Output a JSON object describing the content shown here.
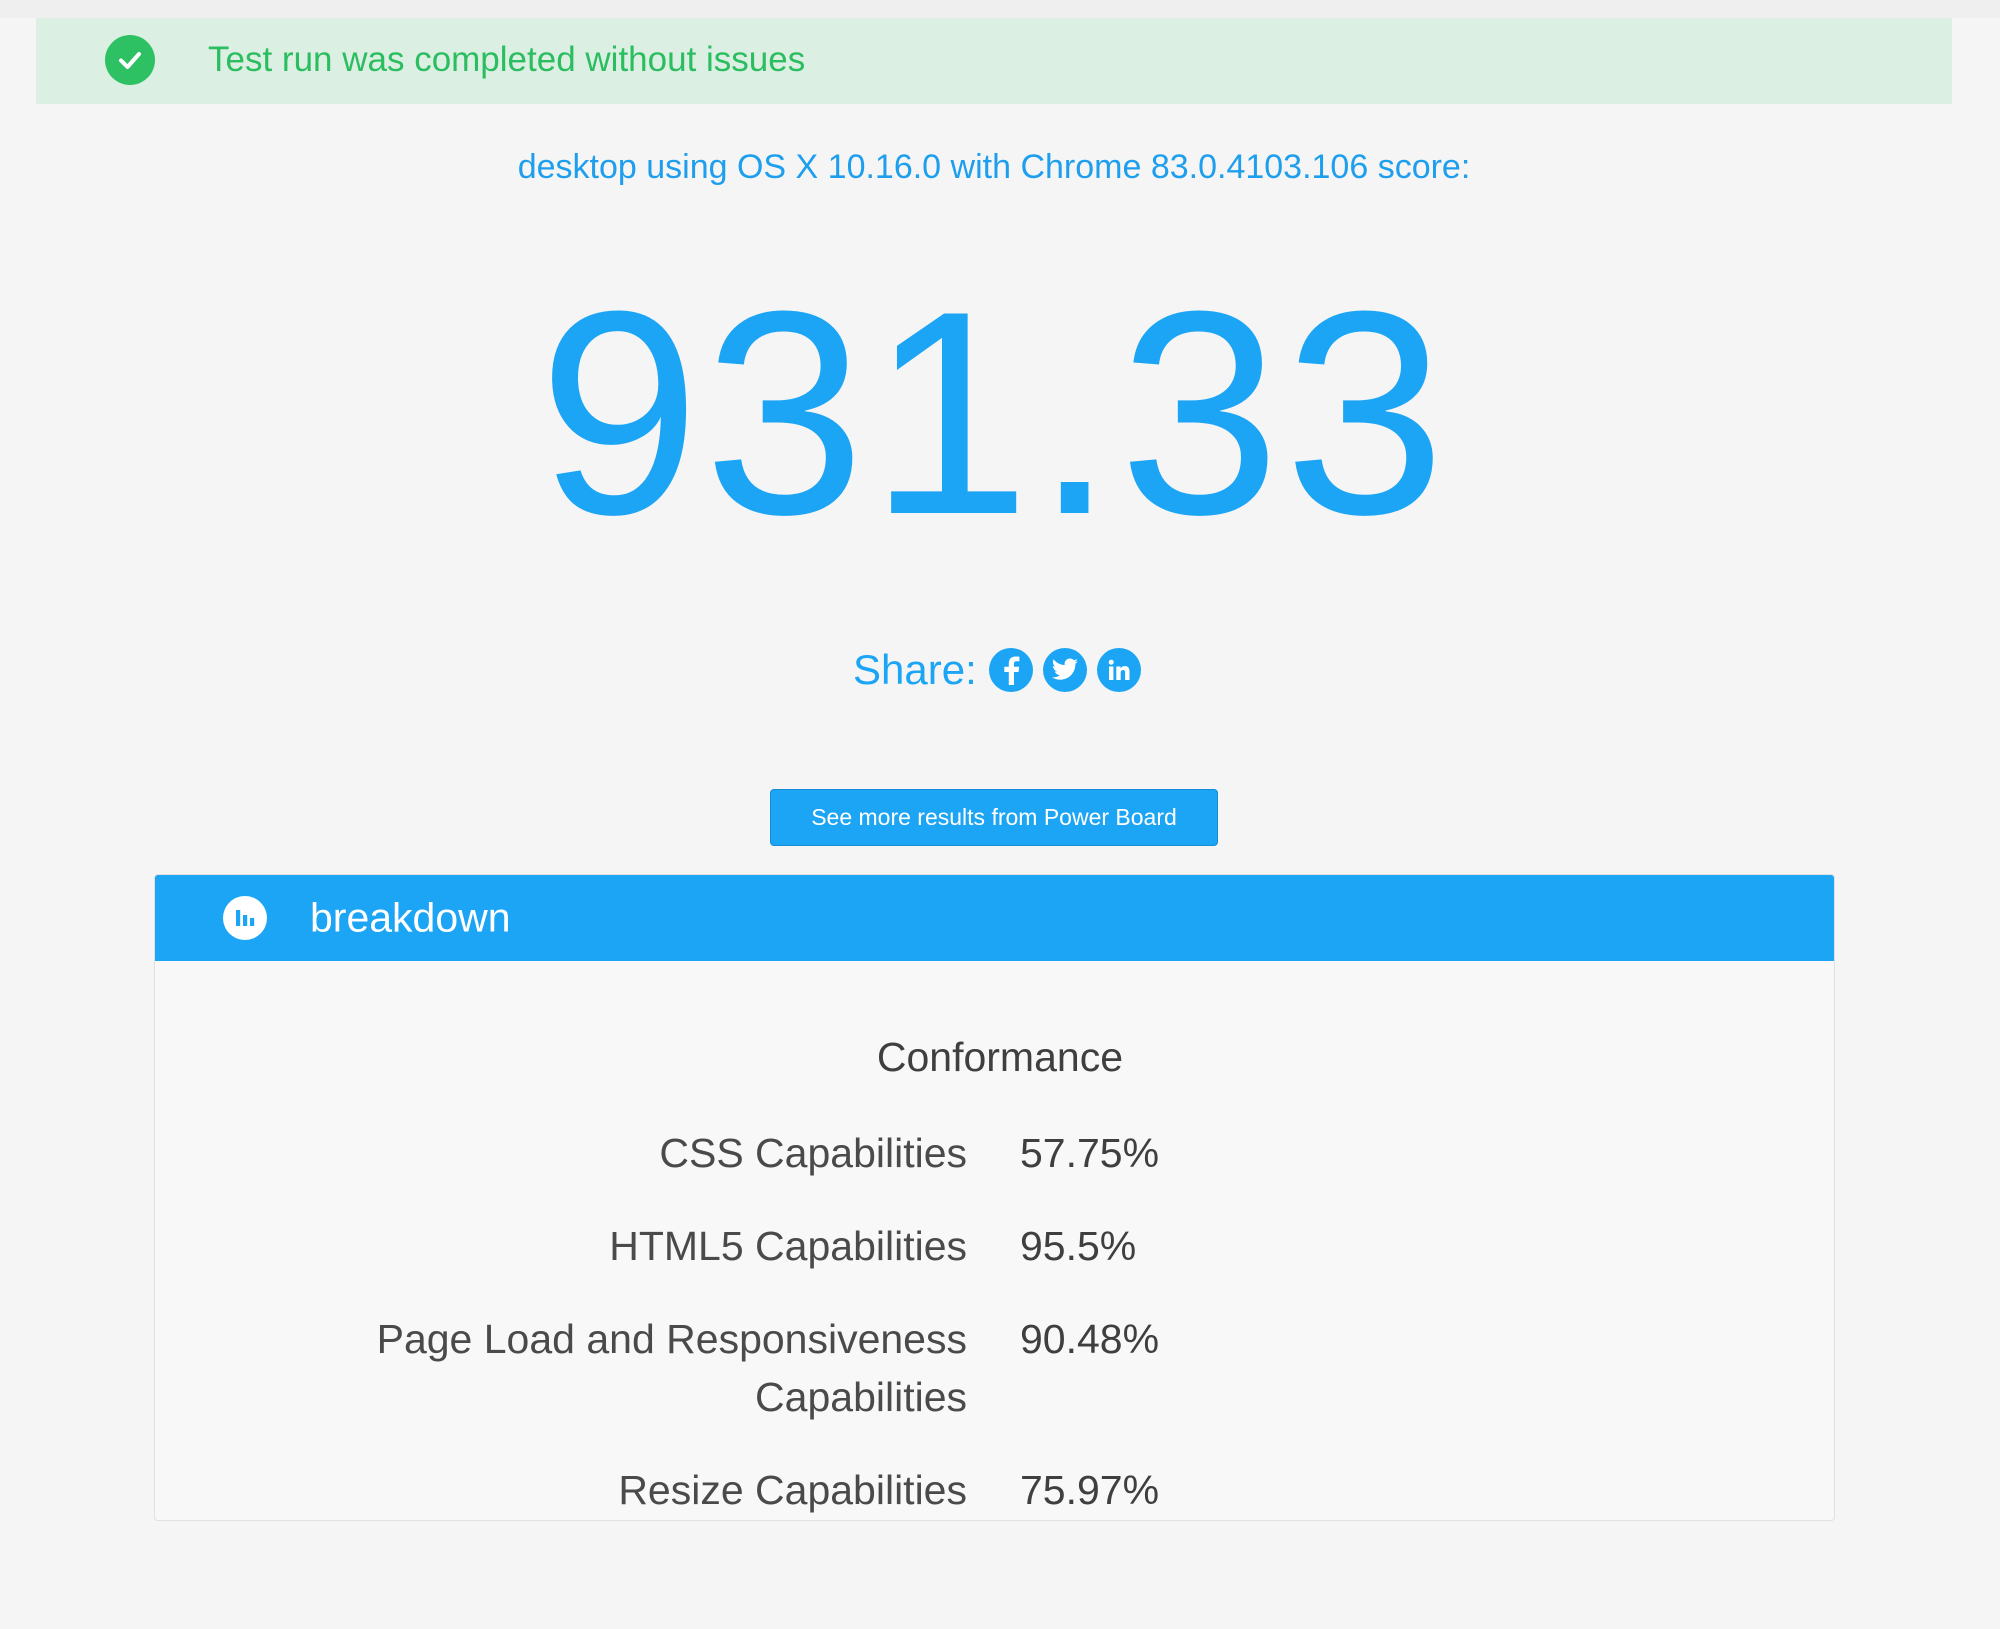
{
  "alert": {
    "message": "Test run was completed without issues",
    "icon": "check-circle-icon",
    "color": "#2ec164"
  },
  "result": {
    "subtitle": "desktop using OS X 10.16.0 with Chrome 83.0.4103.106 score:",
    "score": "931.33"
  },
  "share": {
    "label": "Share:",
    "icons": [
      "facebook-icon",
      "twitter-icon",
      "linkedin-icon"
    ]
  },
  "more_button_label": "See more results from Power Board",
  "breakdown": {
    "title": "breakdown",
    "icon": "bar-chart-icon",
    "section": "Conformance",
    "rows": [
      {
        "label": "CSS Capabilities",
        "value": "57.75%"
      },
      {
        "label": "HTML5 Capabilities",
        "value": "95.5%"
      },
      {
        "label": "Page Load and Responsiveness Capabilities",
        "value": "90.48%"
      },
      {
        "label": "Resize Capabilities",
        "value": "75.97%"
      }
    ]
  },
  "colors": {
    "accent": "#1da5f5",
    "success": "#2bbd5f",
    "success_bg": "#dbf0e3"
  }
}
